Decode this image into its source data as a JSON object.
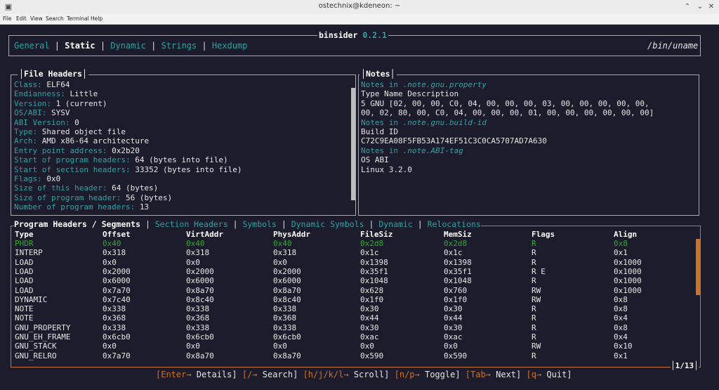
{
  "window": {
    "title": "ostechnix@kdeneon: ~"
  },
  "menu": [
    "File",
    "Edit",
    "View",
    "Search",
    "Terminal",
    "Help"
  ],
  "app": {
    "title": "binsider",
    "version": "0.2.1",
    "path": "/bin/uname"
  },
  "tabs": [
    "General",
    "Static",
    "Dynamic",
    "Strings",
    "Hexdump"
  ],
  "active_tab": "Static",
  "file_headers": {
    "title": "File Headers",
    "rows": [
      {
        "key": "Class:",
        "value": "ELF64"
      },
      {
        "key": "Endianness:",
        "value": "Little"
      },
      {
        "key": "Version:",
        "value": "1 (current)"
      },
      {
        "key": "OS/ABI:",
        "value": "SYSV"
      },
      {
        "key": "ABI Version:",
        "value": "0"
      },
      {
        "key": "Type:",
        "value": "Shared object file"
      },
      {
        "key": "Arch:",
        "value": "AMD x86-64 architecture"
      },
      {
        "key": "Entry point address:",
        "value": "0x2b20"
      },
      {
        "key": "Start of program headers:",
        "value": "64 (bytes into file)"
      },
      {
        "key": "Start of section headers:",
        "value": "33352 (bytes into file)"
      },
      {
        "key": "Flags:",
        "value": "0x0"
      },
      {
        "key": "Size of this header:",
        "value": "64 (bytes)"
      },
      {
        "key": "Size of program header:",
        "value": "56 (bytes)"
      },
      {
        "key": "Number of program headers:",
        "value": "13"
      }
    ]
  },
  "notes": {
    "title": "Notes",
    "lines": [
      {
        "prefix": "Notes in ",
        "section": ".note.gnu.property"
      },
      {
        "text": "Type Name Description"
      },
      {
        "text": "5 GNU [02, 00, 00, C0, 04, 00, 00, 00, 03, 00, 00, 00, 00, 00,"
      },
      {
        "text": "00, 02, 80, 00, C0, 04, 00, 00, 00, 01, 00, 00, 00, 00, 00, 00]"
      },
      {
        "prefix": "Notes in ",
        "section": ".note.gnu.build-id"
      },
      {
        "text": "Build ID"
      },
      {
        "text": "C72C9EA08F5FB53A174EF51C3C0CA5707AD7A630"
      },
      {
        "prefix": "Notes in ",
        "section": ".note.ABI-tag"
      },
      {
        "text": "OS ABI"
      },
      {
        "text": "Linux 3.2.0"
      }
    ]
  },
  "segments": {
    "tabs": [
      "Program Headers / Segments",
      "Section Headers",
      "Symbols",
      "Dynamic Symbols",
      "Dynamic",
      "Relocations"
    ],
    "active_tab": "Program Headers / Segments",
    "columns": [
      "Type",
      "Offset",
      "VirtAddr",
      "PhysAddr",
      "FileSiz",
      "MemSiz",
      "Flags",
      "Align"
    ],
    "rows": [
      [
        "PHDR",
        "0x40",
        "0x40",
        "0x40",
        "0x2d8",
        "0x2d8",
        "R",
        "0x8"
      ],
      [
        "INTERP",
        "0x318",
        "0x318",
        "0x318",
        "0x1c",
        "0x1c",
        "R",
        "0x1"
      ],
      [
        "LOAD",
        "0x0",
        "0x0",
        "0x0",
        "0x1398",
        "0x1398",
        "R",
        "0x1000"
      ],
      [
        "LOAD",
        "0x2000",
        "0x2000",
        "0x2000",
        "0x35f1",
        "0x35f1",
        "R E",
        "0x1000"
      ],
      [
        "LOAD",
        "0x6000",
        "0x6000",
        "0x6000",
        "0x1048",
        "0x1048",
        "R",
        "0x1000"
      ],
      [
        "LOAD",
        "0x7a70",
        "0x8a70",
        "0x8a70",
        "0x628",
        "0x760",
        "RW",
        "0x1000"
      ],
      [
        "DYNAMIC",
        "0x7c40",
        "0x8c40",
        "0x8c40",
        "0x1f0",
        "0x1f0",
        "RW",
        "0x8"
      ],
      [
        "NOTE",
        "0x338",
        "0x338",
        "0x338",
        "0x30",
        "0x30",
        "R",
        "0x8"
      ],
      [
        "NOTE",
        "0x368",
        "0x368",
        "0x368",
        "0x44",
        "0x44",
        "R",
        "0x4"
      ],
      [
        "GNU_PROPERTY",
        "0x338",
        "0x338",
        "0x338",
        "0x30",
        "0x30",
        "R",
        "0x8"
      ],
      [
        "GNU_EH_FRAME",
        "0x6cb0",
        "0x6cb0",
        "0x6cb0",
        "0xac",
        "0xac",
        "R",
        "0x4"
      ],
      [
        "GNU_STACK",
        "0x0",
        "0x0",
        "0x0",
        "0x0",
        "0x0",
        "RW",
        "0x10"
      ],
      [
        "GNU_RELRO",
        "0x7a70",
        "0x8a70",
        "0x8a70",
        "0x590",
        "0x590",
        "R",
        "0x1"
      ]
    ],
    "selected_row": 0,
    "page": "1/13"
  },
  "footer": [
    {
      "key": "[Enter→",
      "label": " Details]"
    },
    {
      "key": "[/→",
      "label": " Search]"
    },
    {
      "key": "[h/j/k/l→",
      "label": " Scroll]"
    },
    {
      "key": "[n/p→",
      "label": " Toggle]"
    },
    {
      "key": "[Tab→",
      "label": " Next]"
    },
    {
      "key": "[q→",
      "label": " Quit]"
    }
  ],
  "colors": {
    "accent_cyan": "#2aa3a3",
    "accent_orange": "#c8742a",
    "selected_green": "#2fa832",
    "background": "#1c1c2c"
  }
}
